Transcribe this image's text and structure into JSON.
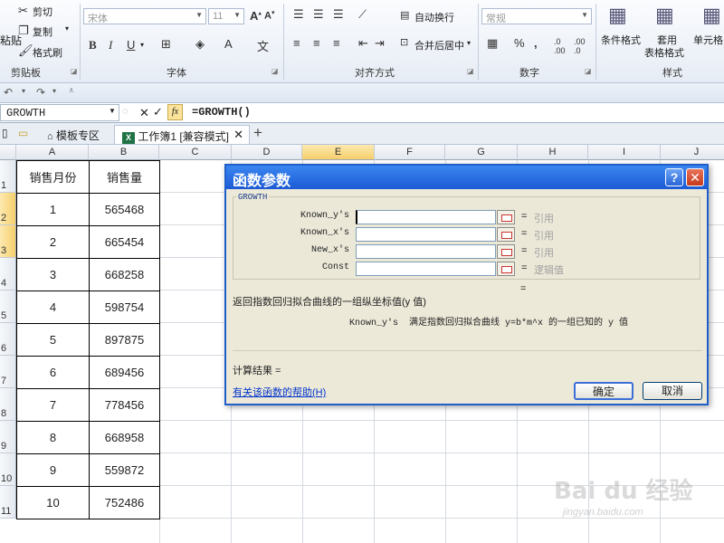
{
  "ribbon": {
    "clipboard": {
      "paste": "粘贴",
      "cut": "剪切",
      "copy": "复制",
      "format_painter": "格式刷",
      "label": "剪贴板"
    },
    "font": {
      "name": "宋体",
      "size": "11",
      "label": "字体"
    },
    "alignment": {
      "wrap_text": "自动换行",
      "merge_center": "合并后居中",
      "label": "对齐方式"
    },
    "number": {
      "format": "常规",
      "label": "数字"
    },
    "styles": {
      "conditional": "条件格式",
      "apply_table_1": "套用",
      "apply_table_2": "表格格式",
      "cell_styles": "单元格",
      "label": "样式"
    }
  },
  "formula_bar": {
    "name_box": "GROWTH",
    "formula": "=GROWTH()"
  },
  "tabs": [
    {
      "label": "模板专区"
    },
    {
      "label": "工作簿1 [兼容模式]"
    }
  ],
  "grid": {
    "columns": [
      "A",
      "B",
      "C",
      "D",
      "E",
      "F",
      "G",
      "H",
      "I",
      "J"
    ],
    "rows": [
      "1",
      "2",
      "3",
      "4",
      "5",
      "6",
      "7",
      "8",
      "9",
      "10",
      "11"
    ],
    "header": [
      "销售月份",
      "销售量"
    ],
    "data": [
      [
        "1",
        "565468"
      ],
      [
        "2",
        "665454"
      ],
      [
        "3",
        "668258"
      ],
      [
        "4",
        "598754"
      ],
      [
        "5",
        "897875"
      ],
      [
        "6",
        "689456"
      ],
      [
        "7",
        "778456"
      ],
      [
        "8",
        "668958"
      ],
      [
        "9",
        "559872"
      ],
      [
        "10",
        "752486"
      ]
    ]
  },
  "dialog": {
    "title": "函数参数",
    "function_name": "GROWTH",
    "args": [
      {
        "label": "Known_y's",
        "result": "引用"
      },
      {
        "label": "Known_x's",
        "result": "引用"
      },
      {
        "label": "New_x's",
        "result": "引用"
      },
      {
        "label": "Const",
        "result": "逻辑值"
      }
    ],
    "eq": "=",
    "description": "返回指数回归拟合曲线的一组纵坐标值(y 值)",
    "arg_help": "Known_y's  满足指数回归拟合曲线 y=b*m^x 的一组已知的 y 值",
    "result_label": "计算结果 =",
    "help_link": "有关该函数的帮助(H)",
    "ok": "确定",
    "cancel": "取消",
    "help_btn": "?",
    "close_btn": "✕"
  },
  "watermark": {
    "brand": "Bai du 经验",
    "url": "jingyan.baidu.com"
  },
  "colors": {
    "accent": "#1f5fc9",
    "close": "#d9472b",
    "selected_col": "#f9d77e"
  }
}
